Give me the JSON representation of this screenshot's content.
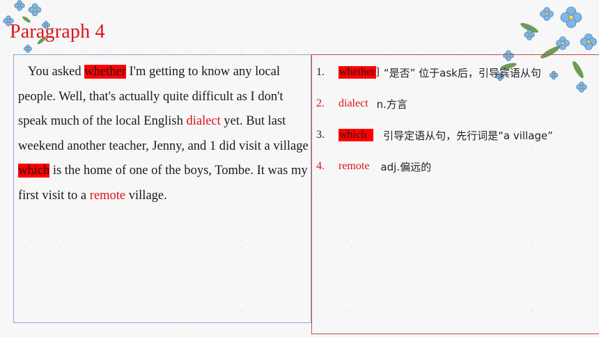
{
  "title": "Paragraph 4",
  "passage": {
    "t1": "You asked ",
    "w1": "whether",
    "t2": " I'm getting to know any local people.  Well, that's actually quite difficult as I don't speak much of the local English ",
    "w2": "dialect",
    "t3": " yet.  But last weekend another teacher, Jenny, and 1 did visit a village ",
    "w3": "which",
    "t4": " is the home of one of the boys, Tombe. It was my first visit to a ",
    "w4": "remote",
    "t5": " village."
  },
  "vocab": [
    {
      "num": "1.",
      "word": "whether",
      "bracket": "]",
      "def": "“是否” 位于ask后，引导宾语从句"
    },
    {
      "num": "2.",
      "word": "dialect",
      "bracket": "",
      "def": "n.方言"
    },
    {
      "num": "3.",
      "word": "which",
      "bracket": "",
      "def": "引导定语从句，先行词是“a village”"
    },
    {
      "num": "4.",
      "word": "remote",
      "bracket": "",
      "def": "adj.偏远的"
    }
  ],
  "colors": {
    "accent_red": "#e0101a",
    "highlight": "#ff0000",
    "left_border": "#8ea8d8",
    "right_border": "#c64a4a"
  },
  "decorations": [
    "flower-cluster-top-left-icon",
    "flower-cluster-top-right-icon"
  ]
}
